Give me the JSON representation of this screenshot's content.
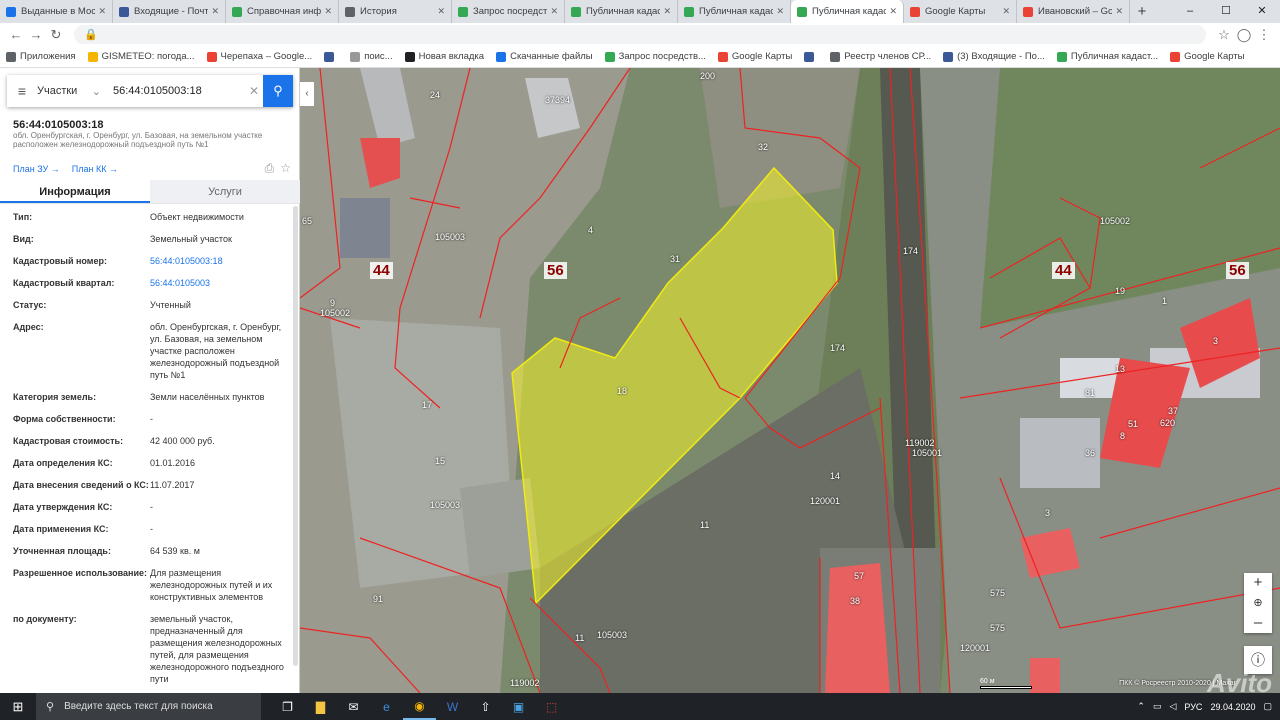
{
  "browser": {
    "tabs": [
      {
        "title": "Выданные в Моск",
        "color": "#1a73e8",
        "active": false
      },
      {
        "title": "Входящие - Почта",
        "color": "#3b5998",
        "active": false
      },
      {
        "title": "Справочная инф",
        "color": "#34a853",
        "active": false
      },
      {
        "title": "История",
        "color": "#5f6368",
        "active": false
      },
      {
        "title": "Запрос посредств",
        "color": "#34a853",
        "active": false
      },
      {
        "title": "Публичная кадаст",
        "color": "#34a853",
        "active": false
      },
      {
        "title": "Публичная кадаст",
        "color": "#34a853",
        "active": false
      },
      {
        "title": "Публичная кадаст",
        "color": "#34a853",
        "active": true
      },
      {
        "title": "Google Карты",
        "color": "#ea4335",
        "active": false
      },
      {
        "title": "Ивановский – Goo",
        "color": "#ea4335",
        "active": false
      }
    ],
    "new_tab": "+",
    "window_controls": [
      "–",
      "☐",
      "✕"
    ],
    "url": "",
    "bookmarks": [
      {
        "label": "Приложения",
        "color": "#5f6368"
      },
      {
        "label": "GISMETEO: погода...",
        "color": "#f4b400"
      },
      {
        "label": "Черепаха – Google...",
        "color": "#ea4335"
      },
      {
        "label": "",
        "color": "#3b5998"
      },
      {
        "label": "поис...",
        "color": "#999999"
      },
      {
        "label": "Новая вкладка",
        "color": "#202124"
      },
      {
        "label": "Скачанные файлы",
        "color": "#1a73e8"
      },
      {
        "label": "Запрос посредств...",
        "color": "#34a853"
      },
      {
        "label": "Google Карты",
        "color": "#ea4335"
      },
      {
        "label": "",
        "color": "#3b5998"
      },
      {
        "label": "Реестр членов СР...",
        "color": "#5f6368"
      },
      {
        "label": "(3) Входящие - По...",
        "color": "#3b5998"
      },
      {
        "label": "Публичная кадаст...",
        "color": "#34a853"
      },
      {
        "label": "Google Карты",
        "color": "#ea4335"
      }
    ]
  },
  "panel": {
    "search": {
      "type": "Участки",
      "query": "56:44:0105003:18"
    },
    "title": "56:44:0105003:18",
    "address": "обл. Оренбургская, г. Оренбург, ул. Базовая, на земельном участке расположен железнодорожный подъездной путь №1",
    "link_plan_zu": "План ЗУ →",
    "link_plan_kk": "План КК →",
    "tab_info": "Информация",
    "tab_services": "Услуги",
    "rows": [
      {
        "k": "Тип:",
        "v": "Объект недвижимости",
        "link": false
      },
      {
        "k": "Вид:",
        "v": "Земельный участок",
        "link": false
      },
      {
        "k": "Кадастровый номер:",
        "v": "56:44:0105003:18",
        "link": true
      },
      {
        "k": "Кадастровый квартал:",
        "v": "56:44:0105003",
        "link": true
      },
      {
        "k": "Статус:",
        "v": "Учтенный",
        "link": false
      },
      {
        "k": "Адрес:",
        "v": "обл. Оренбургская, г. Оренбург, ул. Базовая, на земельном участке расположен железнодорожный подъездной путь №1",
        "link": false
      },
      {
        "k": "Категория земель:",
        "v": "Земли населённых пунктов",
        "link": false
      },
      {
        "k": "Форма собственности:",
        "v": "-",
        "link": false
      },
      {
        "k": "Кадастровая стоимость:",
        "v": "42 400 000 руб.",
        "link": false
      },
      {
        "k": "Дата определения КС:",
        "v": "01.01.2016",
        "link": false
      },
      {
        "k": "Дата внесения сведений о КС:",
        "v": "11.07.2017",
        "link": false
      },
      {
        "k": "Дата утверждения КС:",
        "v": "-",
        "link": false
      },
      {
        "k": "Дата применения КС:",
        "v": "-",
        "link": false
      },
      {
        "k": "Уточненная площадь:",
        "v": "64 539 кв. м",
        "link": false
      },
      {
        "k": "Разрешенное использование:",
        "v": "Для размещения железнодорожных путей и их конструктивных элементов",
        "link": false
      },
      {
        "k": "по документу:",
        "v": "земельный участок, предназначенный для размещения железнодорожных путей, для размещения железнодорожного подъездного пути",
        "link": false
      }
    ]
  },
  "map": {
    "quarter_labels": [
      "56",
      "44",
      "56",
      "44",
      "56"
    ],
    "parcel_labels": [
      "200",
      "24",
      "37394",
      "32",
      "4",
      "31",
      "18",
      "17",
      "15",
      "14",
      "11",
      "11",
      "174",
      "174",
      "81",
      "37",
      "51",
      "620",
      "8",
      "3",
      "1",
      "19",
      "13",
      "36",
      "57",
      "38",
      "575",
      "575",
      "65",
      "9",
      "91",
      "3",
      "105003",
      "105003",
      "105003",
      "105002",
      "105002",
      "120001",
      "120001",
      "119002",
      "119002",
      "105001"
    ],
    "copyright": "ПКК © Росреестр 2010-2020 | Maxar",
    "scale": "60 м",
    "watermark": "Avito",
    "zoom_in": "+",
    "zoom_out": "–",
    "info": "ⓘ"
  },
  "taskbar": {
    "search_placeholder": "Введите здесь текст для поиска",
    "lang": "РУС",
    "date": "29.04.2020"
  }
}
